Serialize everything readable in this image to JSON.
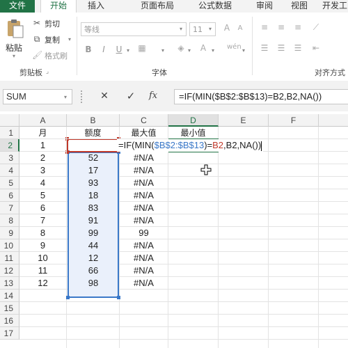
{
  "ribbon_tabs": [
    "文件",
    "开始",
    "插入",
    "页面布局",
    "公式",
    "数据",
    "审阅",
    "视图",
    "开发工"
  ],
  "clipboard": {
    "paste": "粘贴",
    "cut": "剪切",
    "copy": "复制",
    "format_painter": "格式刷",
    "group_label": "剪贴板"
  },
  "font": {
    "font_name": "等线",
    "font_size": "11",
    "bold": "B",
    "italic": "I",
    "underline": "U",
    "group_label": "字体"
  },
  "alignment": {
    "group_label": "对齐方式"
  },
  "formula_bar": {
    "name_box": "SUM",
    "cancel": "✕",
    "enter": "✓",
    "fx": "fx",
    "formula": "=IF(MIN($B$2:$B$13)=B2,B2,NA())"
  },
  "columns": [
    "A",
    "B",
    "C",
    "D",
    "E",
    "F"
  ],
  "rows": [
    "1",
    "2",
    "3",
    "4",
    "5",
    "6",
    "7",
    "8",
    "9",
    "10",
    "11",
    "12",
    "13",
    "14",
    "15",
    "16",
    "17"
  ],
  "sheet": {
    "headers": {
      "A": "月",
      "B": "额度",
      "C": "最大值",
      "D": "最小值"
    },
    "edit_cell": {
      "part1": "=IF(MIN(",
      "part2": "$B$2:$B$13",
      "part3": ")=",
      "part4": "B2",
      "part5": ",B2,NA())"
    },
    "data_rows": [
      {
        "A": "1",
        "B": "",
        "C": ""
      },
      {
        "A": "2",
        "B": "52",
        "C": "#N/A"
      },
      {
        "A": "3",
        "B": "17",
        "C": "#N/A"
      },
      {
        "A": "4",
        "B": "93",
        "C": "#N/A"
      },
      {
        "A": "5",
        "B": "18",
        "C": "#N/A"
      },
      {
        "A": "6",
        "B": "83",
        "C": "#N/A"
      },
      {
        "A": "7",
        "B": "91",
        "C": "#N/A"
      },
      {
        "A": "8",
        "B": "99",
        "C": "99"
      },
      {
        "A": "9",
        "B": "44",
        "C": "#N/A"
      },
      {
        "A": "10",
        "B": "12",
        "C": "#N/A"
      },
      {
        "A": "11",
        "B": "66",
        "C": "#N/A"
      },
      {
        "A": "12",
        "B": "98",
        "C": "#N/A"
      }
    ]
  },
  "colors": {
    "accent": "#217346",
    "ref_blue": "#3a78c8",
    "ref_red": "#c0392b"
  }
}
